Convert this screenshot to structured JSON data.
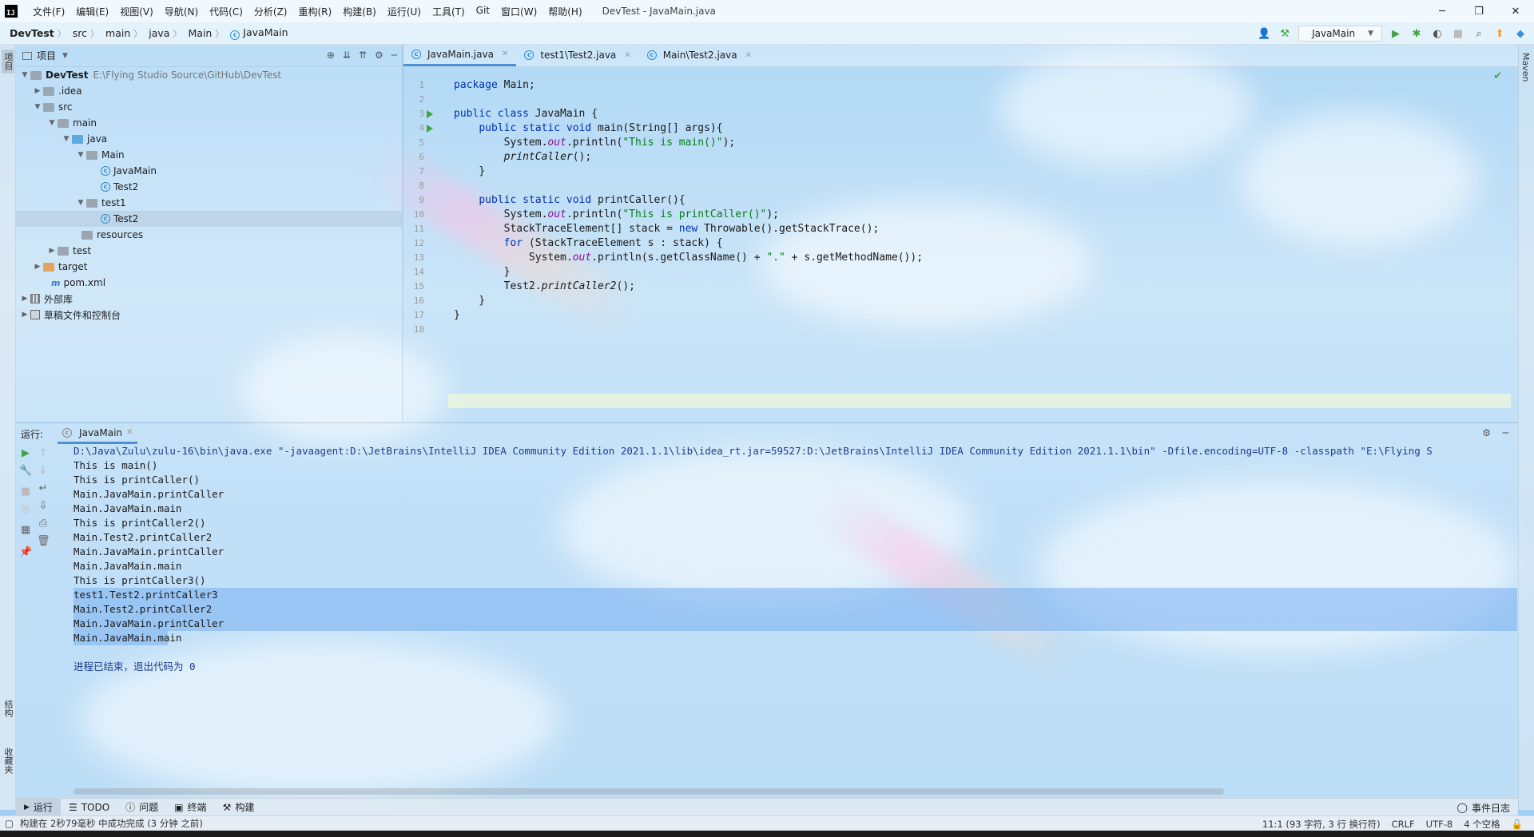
{
  "window": {
    "title": "DevTest - JavaMain.java",
    "menu": [
      "文件(F)",
      "编辑(E)",
      "视图(V)",
      "导航(N)",
      "代码(C)",
      "分析(Z)",
      "重构(R)",
      "构建(B)",
      "运行(U)",
      "工具(T)",
      "Git",
      "窗口(W)",
      "帮助(H)"
    ],
    "controls": {
      "minimize": "─",
      "maximize": "❐",
      "close": "✕"
    }
  },
  "breadcrumb": [
    "DevTest",
    "src",
    "main",
    "java",
    "Main",
    "JavaMain"
  ],
  "run_config": {
    "label": "JavaMain"
  },
  "left_stripe": {
    "project": "项目",
    "structure": "结构",
    "favorites": "收藏夹"
  },
  "right_stripe": {
    "maven": "Maven"
  },
  "project_panel": {
    "title": "项目",
    "tree": [
      {
        "label": "DevTest",
        "hint": "E:\\Flying Studio Source\\GitHub\\DevTest"
      },
      {
        "label": ".idea"
      },
      {
        "label": "src"
      },
      {
        "label": "main"
      },
      {
        "label": "java"
      },
      {
        "label": "Main"
      },
      {
        "label": "JavaMain"
      },
      {
        "label": "Test2"
      },
      {
        "label": "test1"
      },
      {
        "label": "Test2"
      },
      {
        "label": "resources"
      },
      {
        "label": "test"
      },
      {
        "label": "target"
      },
      {
        "label": "pom.xml"
      },
      {
        "label": "外部库"
      },
      {
        "label": "草稿文件和控制台"
      }
    ]
  },
  "editor": {
    "tabs": [
      "JavaMain.java",
      "test1\\Test2.java",
      "Main\\Test2.java"
    ],
    "line_numbers": [
      "1",
      "2",
      "3",
      "4",
      "5",
      "6",
      "7",
      "8",
      "9",
      "10",
      "11",
      "12",
      "13",
      "14",
      "15",
      "16",
      "17",
      "18"
    ]
  },
  "run_panel": {
    "label": "运行:",
    "tab": "JavaMain",
    "console": [
      "D:\\Java\\Zulu\\zulu-16\\bin\\java.exe \"-javaagent:D:\\JetBrains\\IntelliJ IDEA Community Edition 2021.1.1\\lib\\idea_rt.jar=59527:D:\\JetBrains\\IntelliJ IDEA Community Edition 2021.1.1\\bin\" -Dfile.encoding=UTF-8 -classpath \"E:\\Flying S",
      "This is main()",
      "This is printCaller()",
      "Main.JavaMain.printCaller",
      "Main.JavaMain.main",
      "This is printCaller2()",
      "Main.Test2.printCaller2",
      "Main.JavaMain.printCaller",
      "Main.JavaMain.main",
      "This is printCaller3()",
      "test1.Test2.printCaller3",
      "Main.Test2.printCaller2",
      "Main.JavaMain.printCaller",
      "Main.JavaMain.main",
      "",
      "进程已结束，退出代码为 0"
    ]
  },
  "tool_tabs": {
    "run": "运行",
    "todo": "TODO",
    "problems": "问题",
    "terminal": "终端",
    "build": "构建",
    "event_log": "事件日志"
  },
  "status": {
    "left": "构建在 2秒79毫秒 中成功完成 (3 分钟 之前)",
    "position": "11:1 (93 字符, 3 行 换行符)",
    "line_sep": "CRLF",
    "encoding": "UTF-8",
    "indent": "4 个空格"
  }
}
